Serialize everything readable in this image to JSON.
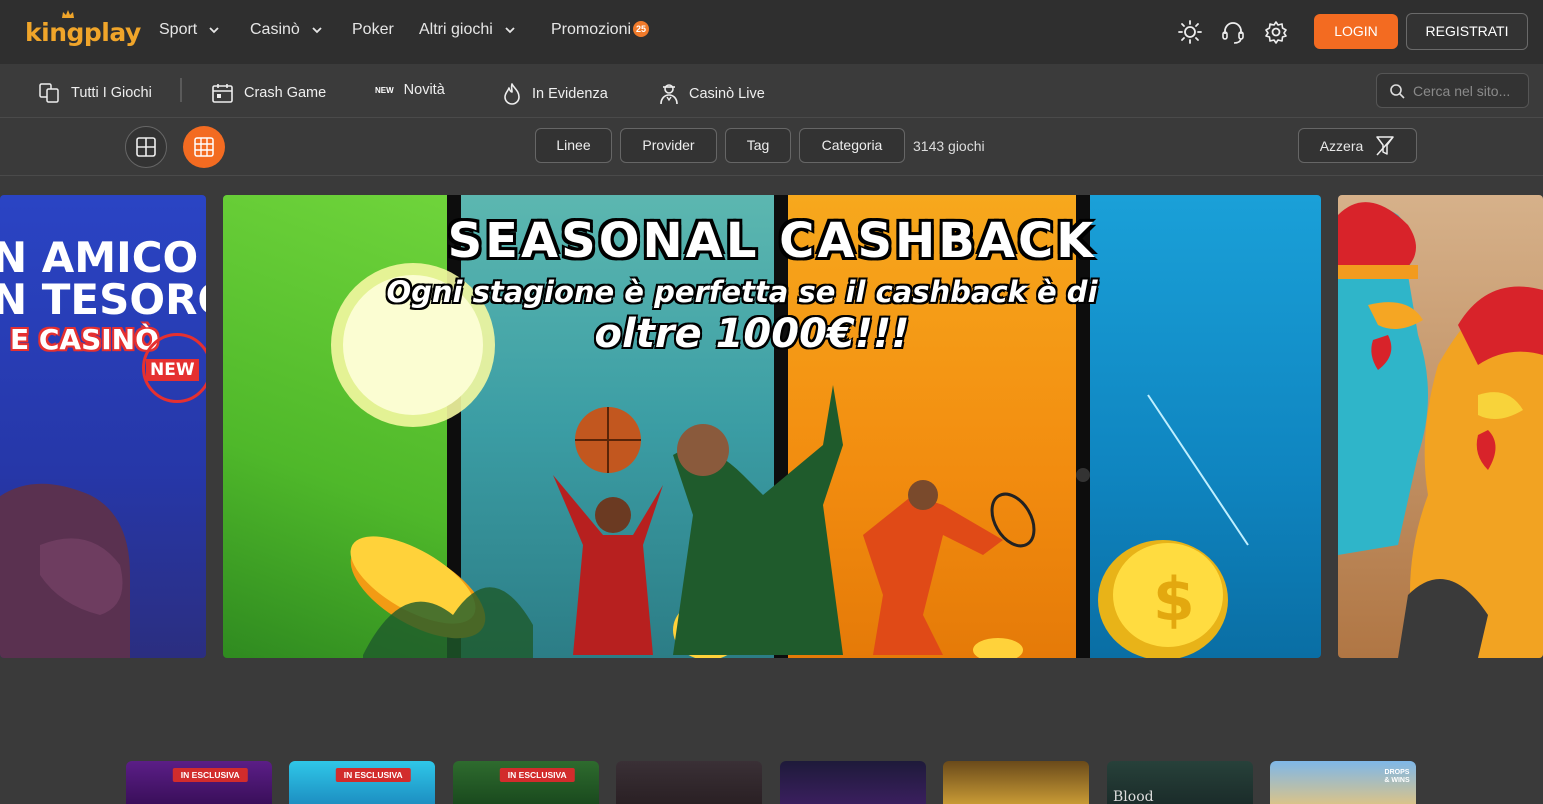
{
  "brand": {
    "logo_part1": "king",
    "logo_part2": "play"
  },
  "nav": [
    {
      "label": "Sport",
      "dropdown": true
    },
    {
      "label": "Casinò",
      "dropdown": true
    },
    {
      "label": "Poker",
      "dropdown": false
    },
    {
      "label": "Altri giochi",
      "dropdown": true
    },
    {
      "label": "Promozioni",
      "dropdown": false,
      "badge": "25"
    }
  ],
  "header_actions": {
    "login": "LOGIN",
    "register": "REGISTRATI"
  },
  "subnav": [
    {
      "label": "Tutti I Giochi",
      "icon": "cards-icon"
    },
    {
      "label": "Crash Game",
      "icon": "calendar-icon"
    },
    {
      "label": "Novità",
      "icon": "new-tag",
      "tag": "NEW"
    },
    {
      "label": "In Evidenza",
      "icon": "flame-icon"
    },
    {
      "label": "Casinò Live",
      "icon": "dealer-icon"
    }
  ],
  "search": {
    "placeholder": "Cerca nel sito..."
  },
  "filters": {
    "chips": [
      "Linee",
      "Provider",
      "Tag",
      "Categoria"
    ],
    "count": "3143 giochi",
    "reset": "Azzera"
  },
  "banners": {
    "left": {
      "line1": "N AMICO",
      "line2": "N TESORO",
      "line3": "E CASINÒ",
      "badge": "NEW"
    },
    "main": {
      "title": "SEASONAL CASHBACK",
      "subtitle": "Ogni stagione è perfetta se il cashback è di",
      "amount": "oltre 1000€!!!"
    }
  },
  "games": [
    {
      "tag": "IN ESCLUSIVA"
    },
    {
      "tag": "IN ESCLUSIVA"
    },
    {
      "tag": "IN ESCLUSIVA"
    },
    {
      "tag": ""
    },
    {
      "tag": ""
    },
    {
      "tag": ""
    },
    {
      "tag": "",
      "caption": "Blood"
    },
    {
      "tag": "",
      "caption": "DROPS & WINS"
    }
  ],
  "colors": {
    "accent": "#f36b21",
    "logo": "#f0a52a",
    "background": "#3a3a3a",
    "header": "#2f2f2f"
  }
}
